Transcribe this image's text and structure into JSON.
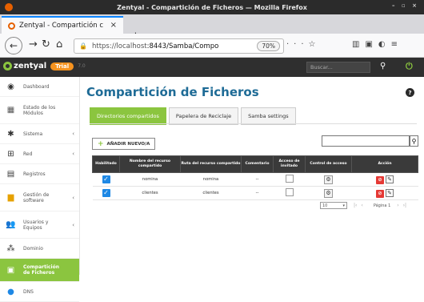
{
  "window": {
    "title": "Zentyal - Compartición de Ficheros — Mozilla Firefox",
    "controls": "– ▫ ×"
  },
  "browser": {
    "tab_label": "Zentyal - Compartición c",
    "tab_close": "×",
    "new_tab": "+",
    "url_host": "https://localhost",
    "url_rest": ":8443/Samba/Compo",
    "zoom": "70%"
  },
  "zentyal": {
    "brand": "zentyal",
    "trial": "Trial",
    "version": "7.0",
    "search_placeholder": "Buscar..."
  },
  "sidebar": {
    "items": [
      {
        "label": "Dashboard",
        "icon": "dashboard-icon",
        "arrow": ""
      },
      {
        "label": "Estado de los Módulos",
        "icon": "modules-icon",
        "arrow": ""
      },
      {
        "label": "Sistema",
        "icon": "system-icon",
        "arrow": "‹"
      },
      {
        "label": "Red",
        "icon": "network-icon",
        "arrow": "‹"
      },
      {
        "label": "Registros",
        "icon": "logs-icon",
        "arrow": ""
      },
      {
        "label": "Gestión de software",
        "icon": "software-icon",
        "arrow": "‹"
      },
      {
        "label": "Usuarios y Equipos",
        "icon": "users-icon",
        "arrow": "‹"
      },
      {
        "label": "Dominio",
        "icon": "domain-icon",
        "arrow": ""
      },
      {
        "label": "Compartición de Ficheros",
        "icon": "file-share-icon",
        "arrow": ""
      },
      {
        "label": "DNS",
        "icon": "dns-icon",
        "arrow": ""
      }
    ]
  },
  "main": {
    "title": "Compartición de Ficheros",
    "help": "?",
    "tabs": [
      "Directorios compartidos",
      "Papelera de Reciclaje",
      "Samba settings"
    ],
    "add_button": "AÑADIR NUEVO/A",
    "table": {
      "headers": [
        "Habilitado",
        "Nombre del recurso compartido",
        "Ruta del recurso compartido",
        "Comentario",
        "Acceso de invitado",
        "Control de acceso",
        "Acción"
      ],
      "rows": [
        {
          "name": "nomina",
          "path": "nomina",
          "comment": "--"
        },
        {
          "name": "clientes",
          "path": "clientes",
          "comment": "--"
        }
      ]
    },
    "pager": {
      "page_size": "10",
      "page_label": "Página 1"
    }
  }
}
